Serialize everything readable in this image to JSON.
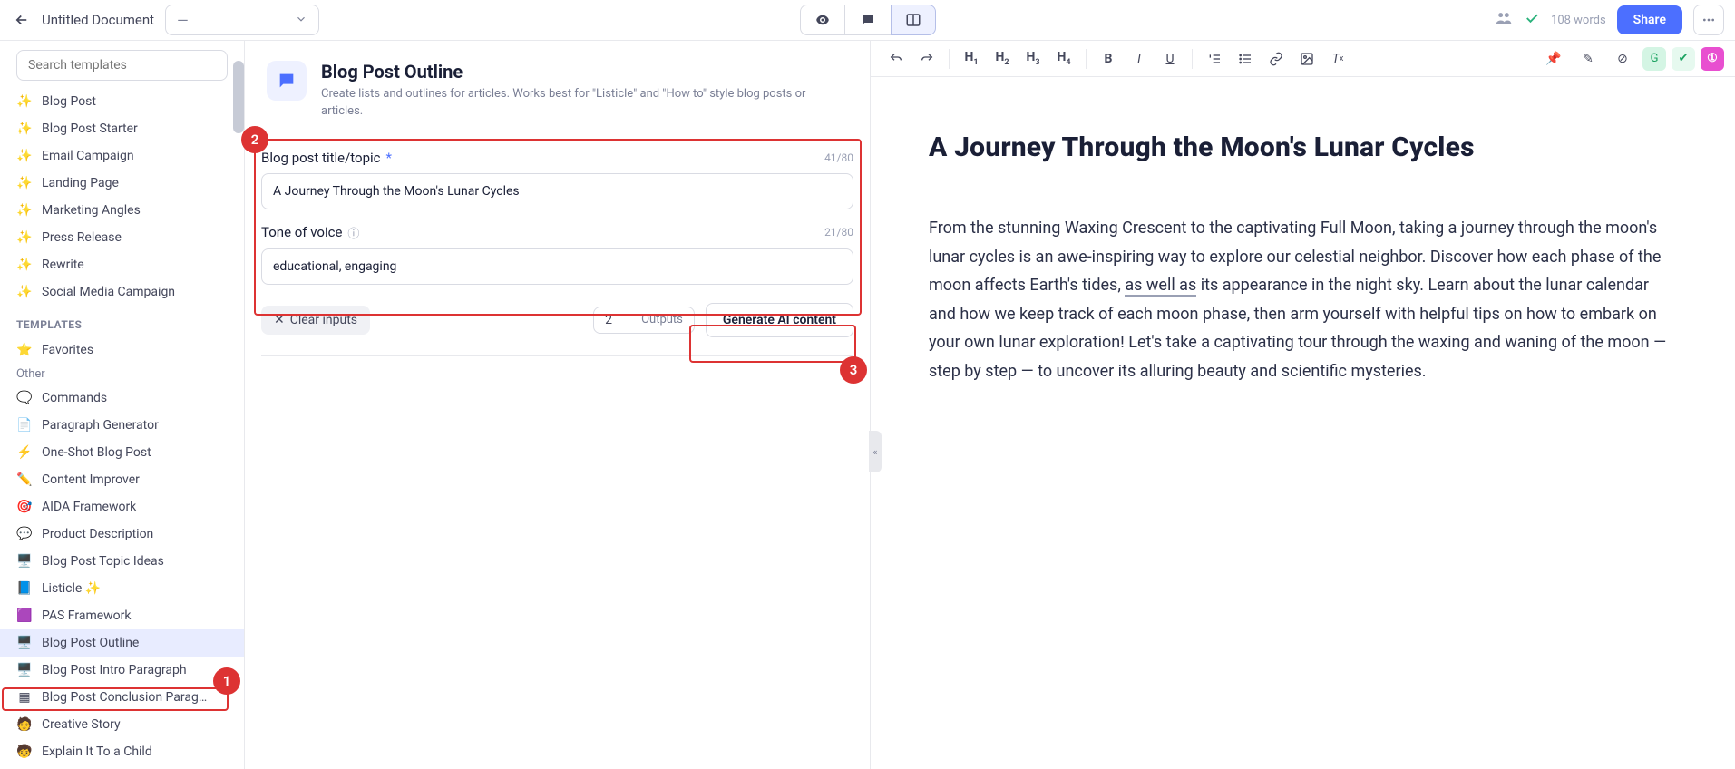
{
  "topbar": {
    "doc_title": "Untitled Document",
    "dropdown_label": "—",
    "word_count": "108 words",
    "share_label": "Share"
  },
  "sidebar": {
    "search_placeholder": "Search templates",
    "workflow_items": [
      "Blog Post",
      "Blog Post Starter",
      "Email Campaign",
      "Landing Page",
      "Marketing Angles",
      "Press Release",
      "Rewrite",
      "Social Media Campaign"
    ],
    "templates_heading": "TEMPLATES",
    "favorites_label": "Favorites",
    "other_label": "Other",
    "other_items": [
      {
        "icon": "🗨️",
        "label": "Commands"
      },
      {
        "icon": "📄",
        "label": "Paragraph Generator"
      },
      {
        "icon": "⚡",
        "label": "One-Shot Blog Post"
      },
      {
        "icon": "✏️",
        "label": "Content Improver"
      },
      {
        "icon": "🎯",
        "label": "AIDA Framework"
      },
      {
        "icon": "💬",
        "label": "Product Description"
      },
      {
        "icon": "🖥️",
        "label": "Blog Post Topic Ideas"
      },
      {
        "icon": "📘",
        "label": "Listicle ✨"
      },
      {
        "icon": "🟪",
        "label": "PAS Framework"
      },
      {
        "icon": "🖥️",
        "label": "Blog Post Outline",
        "selected": true
      },
      {
        "icon": "🖥️",
        "label": "Blog Post Intro Paragraph"
      },
      {
        "icon": "▦",
        "label": "Blog Post Conclusion Parag…"
      },
      {
        "icon": "🧑",
        "label": "Creative Story"
      },
      {
        "icon": "🧒",
        "label": "Explain It To a Child"
      }
    ]
  },
  "form": {
    "title": "Blog Post Outline",
    "description": "Create lists and outlines for articles. Works best for \"Listicle\" and \"How to\" style blog posts or articles.",
    "field1": {
      "label": "Blog post title/topic",
      "count": "41/80",
      "value": "A Journey Through the Moon's Lunar Cycles"
    },
    "field2": {
      "label": "Tone of voice",
      "count": "21/80",
      "value": "educational, engaging"
    },
    "clear_label": "Clear inputs",
    "outputs_value": "2",
    "outputs_label": "Outputs",
    "generate_label": "Generate AI content"
  },
  "editor": {
    "heading": "A Journey Through the Moon's Lunar Cycles",
    "p_before": "From the stunning Waxing Crescent to the captivating Full Moon, taking a journey through the moon's lunar cycles is an awe-inspiring way to explore our celestial neighbor. Discover how each phase of the moon affects Earth's tides, ",
    "p_hl": "as well as",
    "p_after": " its appearance in the night sky. Learn about the lunar calendar and how we keep track of each moon phase, then arm yourself with helpful tips on how to embark on your own lunar exploration! Let's take a captivating tour through the waxing and waning of the moon — step by step — to uncover its alluring beauty and scientific mysteries."
  },
  "callouts": {
    "one": "1",
    "two": "2",
    "three": "3"
  }
}
